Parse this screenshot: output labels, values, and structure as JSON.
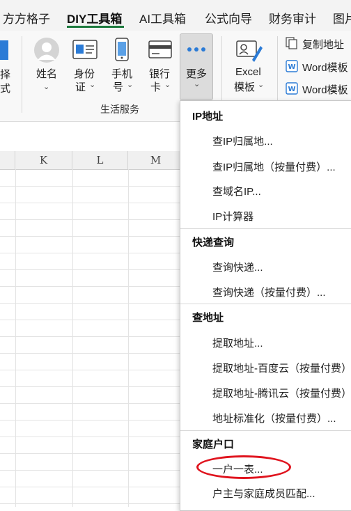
{
  "tabs": [
    "方方格子",
    "DIY工具箱",
    "AI工具箱",
    "公式向导",
    "财务审计",
    "图片"
  ],
  "ribbon": {
    "partial_left": [
      "择",
      "式"
    ],
    "buttons": [
      {
        "line1": "姓名",
        "line2": ""
      },
      {
        "line1": "身份",
        "line2": "证"
      },
      {
        "line1": "手机",
        "line2": "号"
      },
      {
        "line1": "银行",
        "line2": "卡"
      },
      {
        "line1": "更多",
        "line2": ""
      },
      {
        "line1": "Excel",
        "line2": "模板"
      }
    ],
    "group_label": "生活服务",
    "right_items": [
      "复制地址",
      "Word模板",
      "Word模板"
    ],
    "icons": [
      "person-icon",
      "id-card-icon",
      "phone-icon",
      "bank-card-icon",
      "more-dots-icon",
      "excel-template-icon",
      "copy-address-icon",
      "word-icon",
      "word-icon"
    ]
  },
  "columns": [
    "K",
    "L",
    "M"
  ],
  "menu": {
    "sections": [
      {
        "title": "IP地址",
        "items": [
          "查IP归属地...",
          "查IP归属地（按量付费）...",
          "查域名IP...",
          "IP计算器"
        ]
      },
      {
        "title": "快递查询",
        "items": [
          "查询快递...",
          "查询快递（按量付费）..."
        ]
      },
      {
        "title": "查地址",
        "items": [
          "提取地址...",
          "提取地址-百度云（按量付费）",
          "提取地址-腾讯云（按量付费）",
          "地址标准化（按量付费）..."
        ]
      },
      {
        "title": "家庭户口",
        "items": [
          "一户一表...",
          "户主与家庭成员匹配..."
        ]
      }
    ]
  },
  "highlight_color": "#e0141e",
  "active_tab_color": "#1d7a3e"
}
